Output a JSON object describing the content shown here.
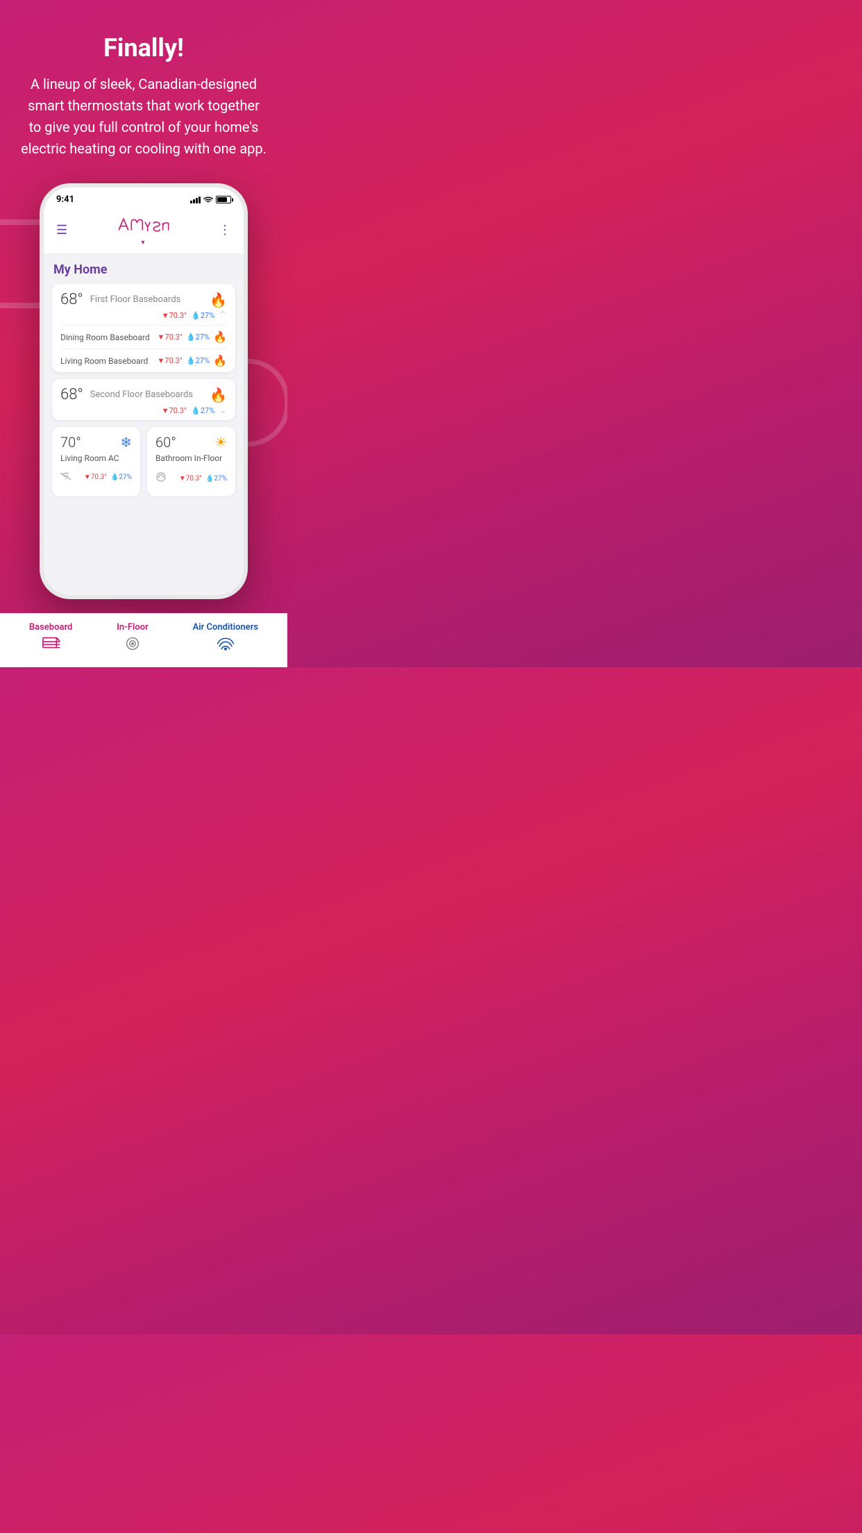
{
  "header": {
    "title": "Finally!",
    "subtitle": "A lineup of sleek, Canadian-designed smart thermostats that work together to give you full control of your home's electric heating or cooling with one app."
  },
  "phone": {
    "status_bar": {
      "time": "9:41"
    },
    "app": {
      "home_label": "My Home",
      "group1": {
        "temp": "68°",
        "name": "First Floor Baseboards",
        "outside_temp": "▼70.3°",
        "humidity": "💧27%",
        "rooms": [
          {
            "name": "Dining Room Baseboard",
            "outside_temp": "▼70.3°",
            "humidity": "💧27%"
          },
          {
            "name": "Living Room Baseboard",
            "outside_temp": "▼70.3°",
            "humidity": "💧27%"
          }
        ]
      },
      "group2": {
        "temp": "68°",
        "name": "Second Floor Baseboards",
        "outside_temp": "▼70.3°",
        "humidity": "💧27%"
      },
      "device1": {
        "temp": "70°",
        "name": "Living Room AC",
        "outside_temp": "▼70.3°",
        "humidity": "💧27%"
      },
      "device2": {
        "temp": "60°",
        "name": "Bathroom In-Floor",
        "outside_temp": "▼70.3°",
        "humidity": "💧27%"
      }
    }
  },
  "bottom_nav": {
    "items": [
      {
        "label": "Baseboard",
        "active": false
      },
      {
        "label": "In-Floor",
        "active": false
      },
      {
        "label": "Air Conditioners",
        "active": true
      }
    ]
  }
}
